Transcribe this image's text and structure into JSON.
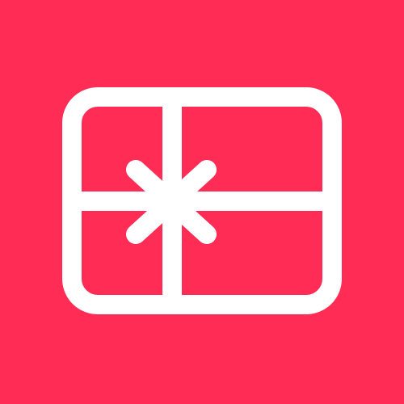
{
  "icon": {
    "name": "gift-card-icon",
    "background_color": "#FF2D55",
    "foreground_color": "#FFFFFF"
  }
}
